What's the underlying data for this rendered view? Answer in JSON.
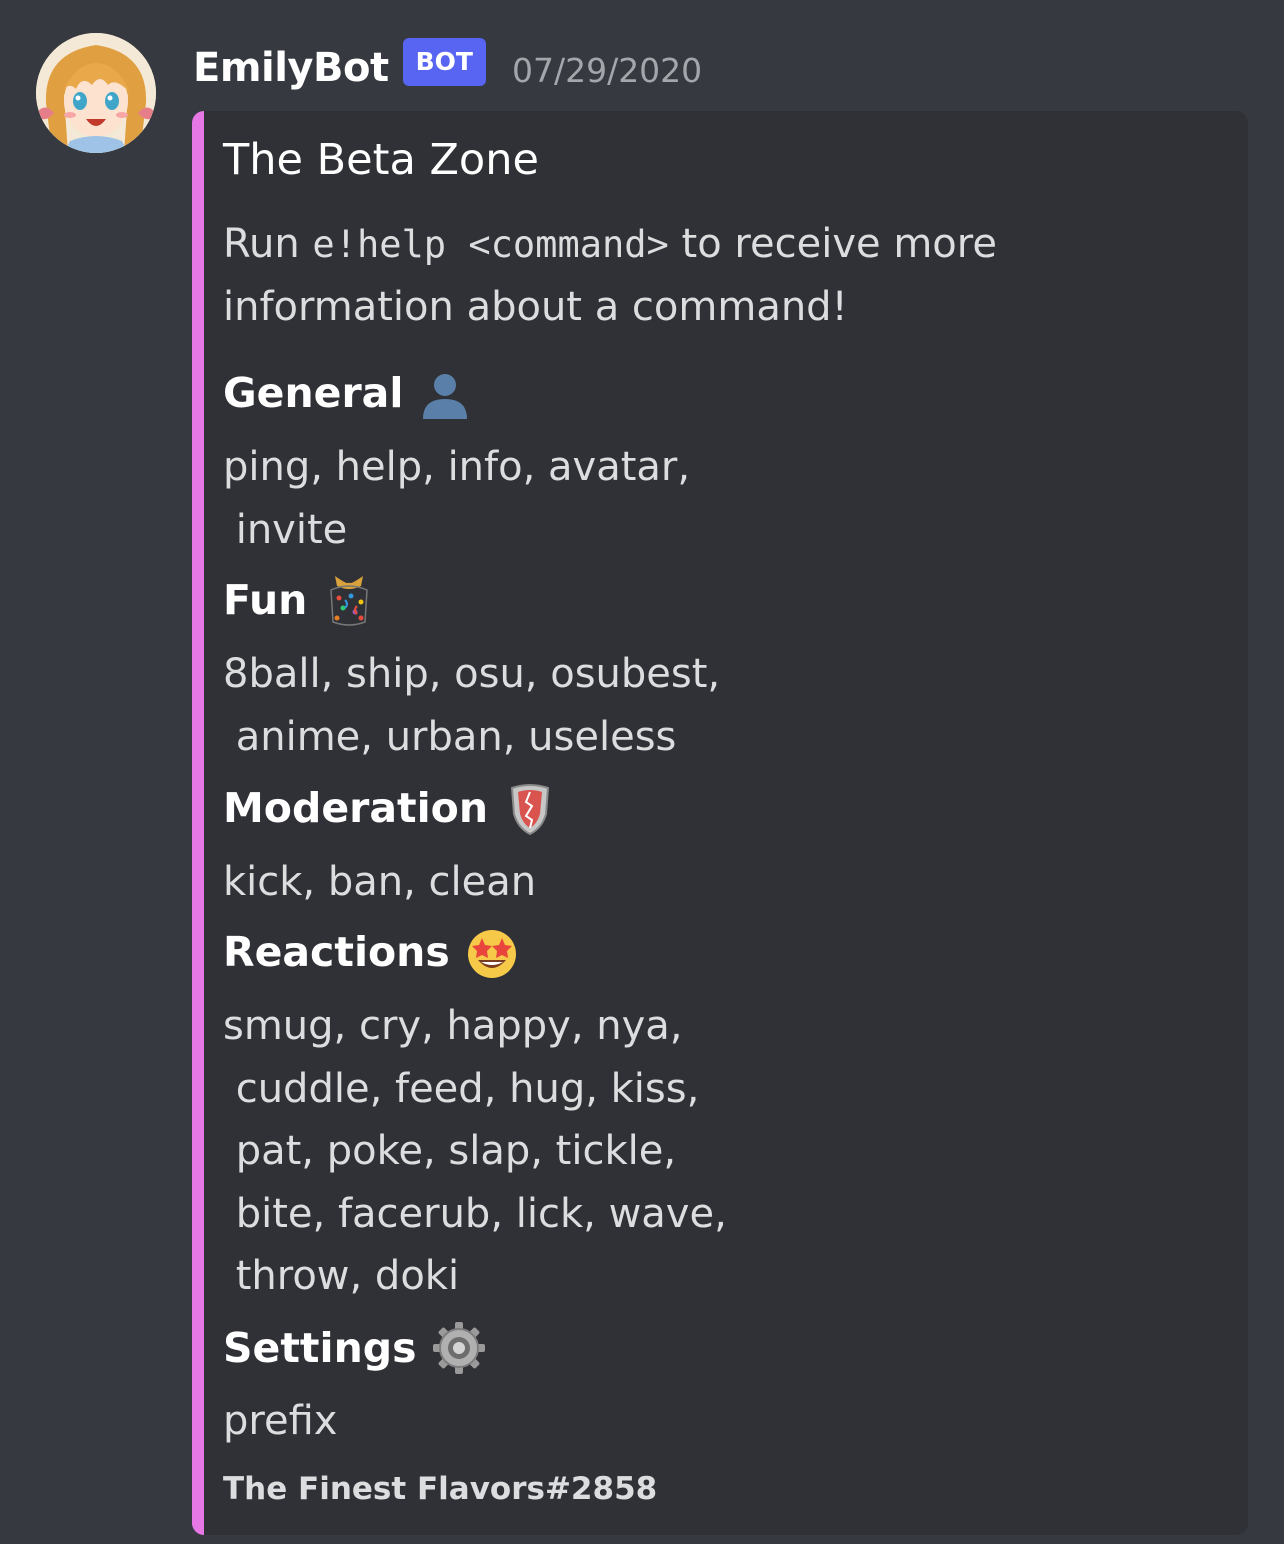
{
  "message": {
    "author": "EmilyBot",
    "bot_tag": "BOT",
    "timestamp": "07/29/2020"
  },
  "embed": {
    "accent_color": "#e678e6",
    "title": "The Beta Zone",
    "description": {
      "before": "Run ",
      "code": "e!help <command>",
      "after": " to receive more information about a command!"
    },
    "fields": [
      {
        "name": "General",
        "icon": "bust-silhouette-icon",
        "lines": [
          "ping, help, info, avatar,",
          " invite"
        ]
      },
      {
        "name": "Fun",
        "icon": "confetti-ball-icon",
        "lines": [
          "8ball, ship, osu, osubest,",
          " anime, urban, useless"
        ]
      },
      {
        "name": "Moderation",
        "icon": "shield-icon",
        "lines": [
          "kick, ban, clean"
        ]
      },
      {
        "name": "Reactions",
        "icon": "star-struck-icon",
        "lines": [
          "smug, cry, happy, nya,",
          " cuddle, feed, hug, kiss,",
          " pat, poke, slap, tickle,",
          " bite, facerub, lick, wave,",
          " throw, doki"
        ]
      },
      {
        "name": "Settings",
        "icon": "gear-icon",
        "lines": [
          "prefix"
        ]
      }
    ],
    "footer": "The Finest Flavors#2858"
  }
}
